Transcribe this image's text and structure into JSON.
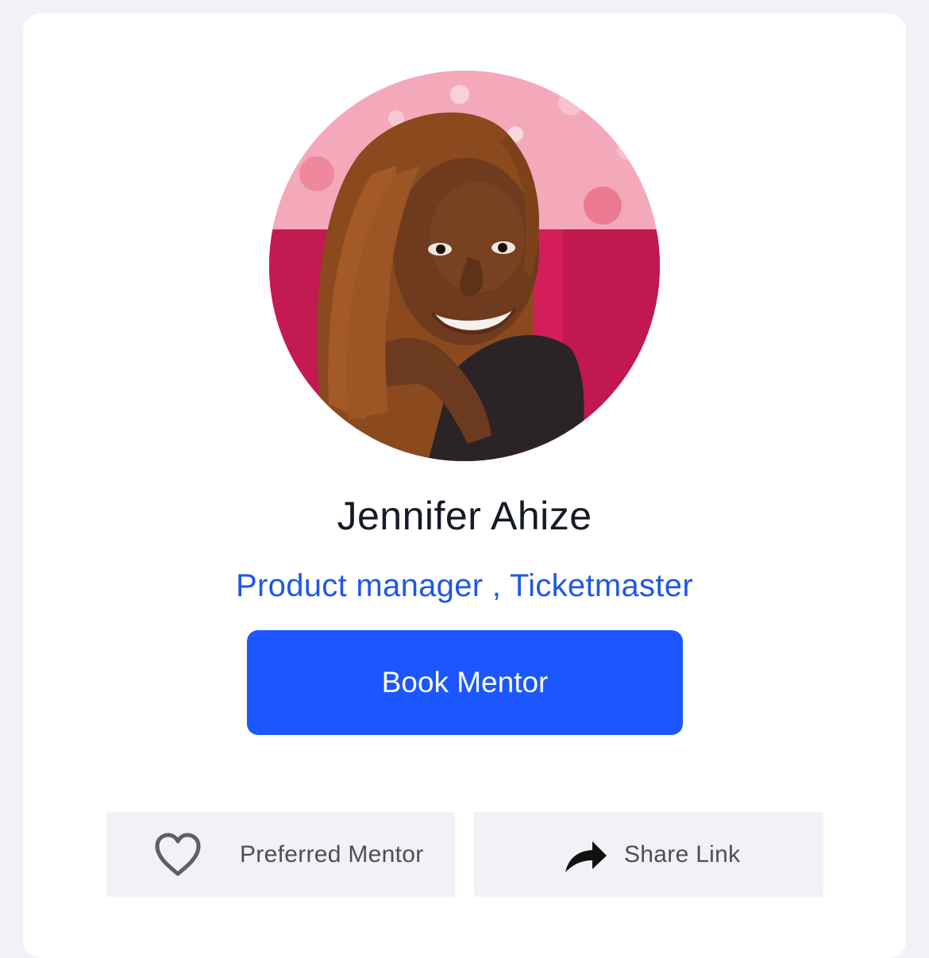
{
  "profile": {
    "name": "Jennifer Ahize",
    "role": "Product manager , Ticketmaster",
    "avatar_icon": "profile-photo"
  },
  "actions": {
    "book_label": "Book Mentor",
    "preferred_label": "Preferred Mentor",
    "preferred_icon": "heart-outline-icon",
    "share_label": "Share Link",
    "share_icon": "share-arrow-icon"
  },
  "colors": {
    "accent": "#1c56ff",
    "role_text": "#1f57e8",
    "page_bg": "#f1f1f7",
    "card_bg": "#ffffff"
  }
}
